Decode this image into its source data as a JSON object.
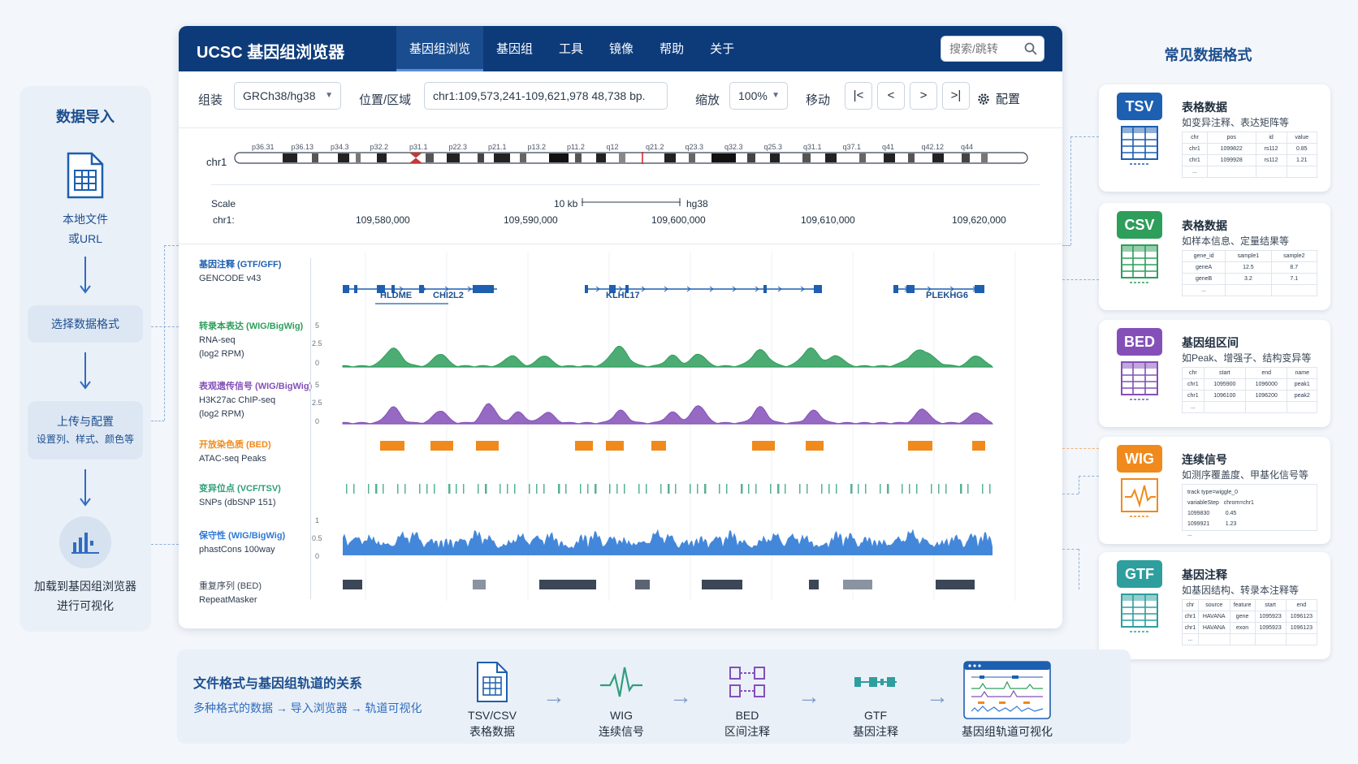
{
  "left_panel": {
    "title": "数据导入",
    "step1": [
      "本地文件",
      "或URL"
    ],
    "step2": "选择数据格式",
    "step3": [
      "上传与配置",
      "设置列、样式、颜色等"
    ],
    "step4": [
      "加载到基因组浏览器",
      "进行可视化"
    ]
  },
  "browser": {
    "title": "UCSC 基因组浏览器",
    "nav": [
      "基因组浏览",
      "基因组",
      "工具",
      "镜像",
      "帮助",
      "关于"
    ],
    "active_nav": 0,
    "search_placeholder": "搜索/跳转",
    "toolbar": {
      "assembly_label": "组装",
      "assembly_value": "GRCh38/hg38",
      "position_label": "位置/区域",
      "position_value": "chr1:109,573,241-109,621,978  48,738 bp.",
      "zoom_label": "缩放",
      "zoom_value": "100%",
      "move_label": "移动",
      "move_buttons": [
        "|<",
        "<",
        ">",
        ">|"
      ],
      "config_label": "配置"
    },
    "ideogram": {
      "chrom": "chr1",
      "bands": [
        "p36.31",
        "p36.13",
        "p34.3",
        "p32.2",
        "p31.1",
        "p22.3",
        "p21.1",
        "p13.2",
        "p11.2",
        "q12",
        "q21.2",
        "q23.3",
        "q32.3",
        "q25.3",
        "q31.1",
        "q37.1",
        "q41",
        "q42.12",
        "q44"
      ]
    },
    "scale": {
      "label": "Scale",
      "chrom_label": "chr1:",
      "bar_label": "10 kb",
      "assembly": "hg38",
      "coords": [
        "109,580,000",
        "109,590,000",
        "109,600,000",
        "109,610,000",
        "109,620,000"
      ]
    },
    "tracks": [
      {
        "type": "基因注释 (GTF/GFF)",
        "name": "GENCODE v43",
        "unit": "",
        "color": "#1d5fb0"
      },
      {
        "type": "转录本表达 (WIG/BigWig)",
        "name": "RNA-seq",
        "unit": "(log2 RPM)",
        "color": "#2e9e5b",
        "yticks": [
          "5",
          "2.5",
          "0"
        ]
      },
      {
        "type": "表观遗传信号 (WIG/BigWig)",
        "name": "H3K27ac ChIP-seq",
        "unit": "(log2 RPM)",
        "color": "#8450b8",
        "yticks": [
          "5",
          "2.5",
          "0"
        ]
      },
      {
        "type": "开放染色质 (BED)",
        "name": "ATAC-seq Peaks",
        "unit": "",
        "color": "#f08a1c"
      },
      {
        "type": "变异位点 (VCF/TSV)",
        "name": "SNPs (dbSNP 151)",
        "unit": "",
        "color": "#2e9e7b"
      },
      {
        "type": "保守性 (WIG/BigWig)",
        "name": "phastCons 100way",
        "unit": "",
        "color": "#2f7ad6",
        "yticks": [
          "1",
          "0.5",
          "0"
        ]
      },
      {
        "type": "重复序列 (BED)",
        "name": "RepeatMasker",
        "unit": "",
        "color": "#3b4656"
      }
    ],
    "genes": [
      "HLDME",
      "CHI2L2",
      "KLHL17",
      "PLEKHG6"
    ]
  },
  "right_panel": {
    "title": "常见数据格式",
    "formats": [
      {
        "badge": "TSV",
        "color": "#1d5fb0",
        "name": "表格数据",
        "desc": "如变异注释、表达矩阵等",
        "header": [
          "chr",
          "pos",
          "id",
          "value"
        ],
        "rows": [
          [
            "chr1",
            "1099822",
            "rs112",
            "0.85"
          ],
          [
            "chr1",
            "1099928",
            "rs112",
            "1.21"
          ],
          [
            "...",
            "",
            "",
            ""
          ]
        ]
      },
      {
        "badge": "CSV",
        "color": "#2e9e5b",
        "name": "表格数据",
        "desc": "如样本信息、定量结果等",
        "header": [
          "gene_id",
          "sample1",
          "sample2"
        ],
        "rows": [
          [
            "geneA",
            "12.5",
            "8.7"
          ],
          [
            "geneB",
            "3.2",
            "7.1"
          ],
          [
            "...",
            "",
            ""
          ]
        ]
      },
      {
        "badge": "BED",
        "color": "#8450b8",
        "name": "基因组区间",
        "desc": "如Peak、增强子、结构变异等",
        "header": [
          "chr",
          "start",
          "end",
          "name"
        ],
        "rows": [
          [
            "chr1",
            "1095900",
            "1096000",
            "peak1"
          ],
          [
            "chr1",
            "1096100",
            "1096200",
            "peak2"
          ],
          [
            "...",
            "",
            "",
            ""
          ]
        ]
      },
      {
        "badge": "WIG",
        "color": "#f08a1c",
        "name": "连续信号",
        "desc": "如测序覆盖度、甲基化信号等",
        "lines": [
          "track type=wiggle_0",
          "variableStep   chrom=chr1",
          "1099830          0.45",
          "1099921          1.23",
          "..."
        ]
      },
      {
        "badge": "GTF",
        "color": "#2e9e9e",
        "name": "基因注释",
        "desc": "如基因结构、转录本注释等",
        "header": [
          "chr",
          "source",
          "feature",
          "start",
          "end"
        ],
        "rows": [
          [
            "chr1",
            "HAVANA",
            "gene",
            "1095923",
            "1096123"
          ],
          [
            "chr1",
            "HAVANA",
            "exon",
            "1095923",
            "1096123"
          ],
          [
            "...",
            "",
            "",
            "",
            ""
          ]
        ]
      }
    ]
  },
  "bottom": {
    "title": "文件格式与基因组轨道的关系",
    "subtitle": "多种格式的数据 → 导入浏览器 → 轨道可视化",
    "items": [
      {
        "name": "TSV/CSV",
        "desc": "表格数据"
      },
      {
        "name": "WIG",
        "desc": "连续信号"
      },
      {
        "name": "BED",
        "desc": "区间注释"
      },
      {
        "name": "GTF",
        "desc": "基因注释"
      },
      {
        "name": "",
        "desc": "基因组轨道可视化"
      }
    ]
  }
}
